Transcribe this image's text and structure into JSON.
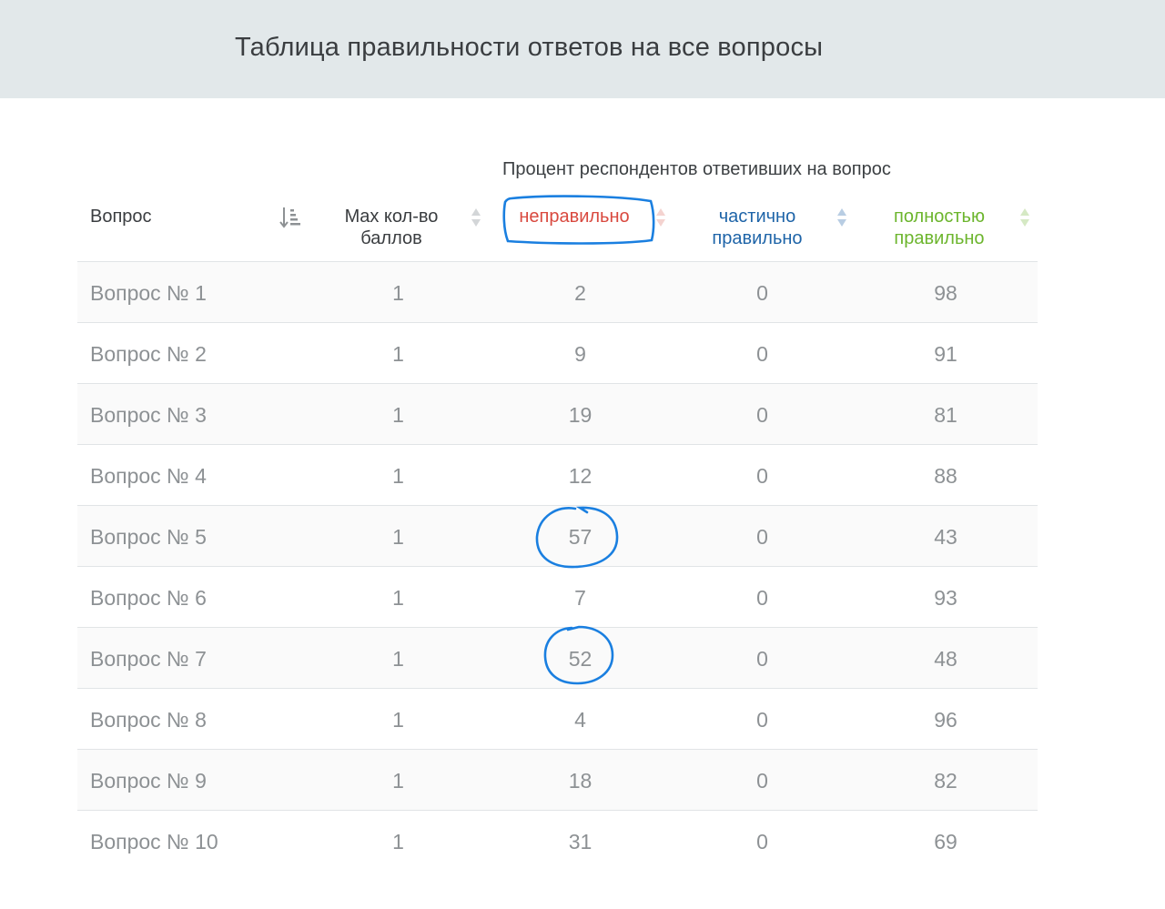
{
  "page": {
    "title": "Таблица правильности ответов на все вопросы"
  },
  "table": {
    "group_label": "Процент респондентов ответивших на вопрос",
    "headers": {
      "question": "Вопрос",
      "max_points_line1": "Max кол-во",
      "max_points_line2": "баллов",
      "wrong": "неправильно",
      "partial_line1": "частично",
      "partial_line2": "правильно",
      "full_line1": "полностью",
      "full_line2": "правильно"
    },
    "rows": [
      {
        "question": "Вопрос № 1",
        "max": "1",
        "wrong": "2",
        "partial": "0",
        "full": "98"
      },
      {
        "question": "Вопрос № 2",
        "max": "1",
        "wrong": "9",
        "partial": "0",
        "full": "91"
      },
      {
        "question": "Вопрос № 3",
        "max": "1",
        "wrong": "19",
        "partial": "0",
        "full": "81"
      },
      {
        "question": "Вопрос № 4",
        "max": "1",
        "wrong": "12",
        "partial": "0",
        "full": "88"
      },
      {
        "question": "Вопрос № 5",
        "max": "1",
        "wrong": "57",
        "partial": "0",
        "full": "43"
      },
      {
        "question": "Вопрос № 6",
        "max": "1",
        "wrong": "7",
        "partial": "0",
        "full": "93"
      },
      {
        "question": "Вопрос № 7",
        "max": "1",
        "wrong": "52",
        "partial": "0",
        "full": "48"
      },
      {
        "question": "Вопрос № 8",
        "max": "1",
        "wrong": "4",
        "partial": "0",
        "full": "96"
      },
      {
        "question": "Вопрос № 9",
        "max": "1",
        "wrong": "18",
        "partial": "0",
        "full": "82"
      },
      {
        "question": "Вопрос № 10",
        "max": "1",
        "wrong": "31",
        "partial": "0",
        "full": "69"
      }
    ]
  },
  "colors": {
    "wrong": "#d9493f",
    "partial": "#1e64a8",
    "full": "#6cb52d",
    "annotation": "#1a7fe0"
  },
  "icons": {
    "question_sort": "sort-descending-icon",
    "column_sort": "sort-arrows-icon"
  }
}
